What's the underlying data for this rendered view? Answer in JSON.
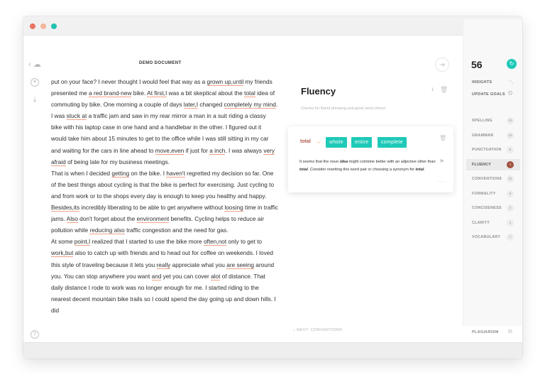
{
  "window": {
    "traffic_lights": [
      "close",
      "minimize",
      "maximize"
    ]
  },
  "document": {
    "title": "DEMO DOCUMENT",
    "paragraphs": [
      [
        {
          "t": "put on your face? I never thought I would feel that way as a "
        },
        {
          "t": "grown up,until",
          "u": true
        },
        {
          "t": " my friends presented me "
        },
        {
          "t": "a red brand-new",
          "u": true
        },
        {
          "t": " bike. "
        },
        {
          "t": "At first,I",
          "u": true
        },
        {
          "t": " was a bit skeptical about the "
        },
        {
          "t": "total",
          "u": true
        },
        {
          "t": " idea of commuting by bike. One morning a couple of days "
        },
        {
          "t": "later,I",
          "u": true
        },
        {
          "t": " changed "
        },
        {
          "t": "completely my mind",
          "u": true
        },
        {
          "t": "."
        }
      ],
      [
        {
          "t": "I was "
        },
        {
          "t": "stuck at",
          "u": true
        },
        {
          "t": " a traffic jam and saw in my rear mirror a man in a suit riding a classy bike with his laptop case in one hand and a handlebar in the other. I figured out it would take him about 15 minutes to get to the office while I was still sitting in my car and waiting for the cars in line ahead to "
        },
        {
          "t": "move,even",
          "u": true
        },
        {
          "t": " if just for "
        },
        {
          "t": "a inch",
          "u": true
        },
        {
          "t": ". I was always "
        },
        {
          "t": "very afraid",
          "u": true
        },
        {
          "t": " of being late for my business meetings."
        }
      ],
      [
        {
          "t": "That is when I decided "
        },
        {
          "t": "getting",
          "u": true
        },
        {
          "t": " on the bike. I "
        },
        {
          "t": "haven't",
          "u": true
        },
        {
          "t": " regretted my decision so far. One of the best things about cycling is that the bike is perfect for exercising. Just cycling to and from work or to the shops every day is enough to keep you healthy and happy. "
        },
        {
          "t": "Besides,its",
          "u": true
        },
        {
          "t": " incredibly liberating to be able to get anywhere without "
        },
        {
          "t": "loosing",
          "u": true
        },
        {
          "t": " time in traffic jams. "
        },
        {
          "t": "Also",
          "u": true
        },
        {
          "t": " don't forget about the "
        },
        {
          "t": "environment",
          "u": true
        },
        {
          "t": " benefits. Cycling helps to reduce air pollution while "
        },
        {
          "t": "reducing also",
          "u": true
        },
        {
          "t": " traffic congestion and the need for gas."
        }
      ],
      [
        {
          "t": "At some "
        },
        {
          "t": "point,I",
          "u": true
        },
        {
          "t": " realized that I started to use the bike more "
        },
        {
          "t": "often,not",
          "u": true
        },
        {
          "t": " only to get to "
        },
        {
          "t": "work,but",
          "u": true
        },
        {
          "t": " also to catch up with friends and to head out for coffee on weekends. I loved this style of traveling because it lets you "
        },
        {
          "t": "really",
          "u": true
        },
        {
          "t": " appreciate what you "
        },
        {
          "t": "are seeing",
          "u": true
        },
        {
          "t": " around you. You can stop anywhere you want "
        },
        {
          "t": "and",
          "u": true
        },
        {
          "t": " yet you can cover "
        },
        {
          "t": "alot",
          "u": true
        },
        {
          "t": " of distance. That daily distance I rode to work was no longer enough for me. I started riding to the nearest decent mountain bike trails so I could spend the day going up and down hills. I did"
        }
      ]
    ]
  },
  "card": {
    "title": "Fluency",
    "count": "1",
    "subtitle": "Checks for fluent phrasing and good word choice"
  },
  "suggestion": {
    "word": "total",
    "alternatives": [
      "whole",
      "entire",
      "complete"
    ],
    "explanation_parts": [
      {
        "t": "It seems that the noun "
      },
      {
        "t": "idea",
        "b": true
      },
      {
        "t": " might combine better with an adjective other than "
      },
      {
        "t": "total",
        "b": true
      },
      {
        "t": ". Consider rewriting this word pair or choosing a synonym for "
      },
      {
        "t": "total",
        "b": true
      },
      {
        "t": "."
      }
    ]
  },
  "next": {
    "label": "NEXT: CONVENTIONS"
  },
  "sidebar": {
    "score": "56",
    "insights_label": "INSIGHTS",
    "goals_label": "UPDATE GOALS",
    "categories": [
      {
        "label": "SPELLING",
        "count": "10",
        "active": false
      },
      {
        "label": "GRAMMAR",
        "count": "15",
        "active": false
      },
      {
        "label": "PUNCTUATION",
        "count": "6",
        "active": false
      },
      {
        "label": "FLUENCY",
        "count": "1",
        "active": true
      },
      {
        "label": "CONVENTIONS",
        "count": "23",
        "active": false
      },
      {
        "label": "FORMALITY",
        "count": "9",
        "active": false
      },
      {
        "label": "CONCISENESS",
        "count": "2",
        "active": false
      },
      {
        "label": "CLARITY",
        "count": "1",
        "active": false
      },
      {
        "label": "VOCABULARY",
        "count": "7",
        "active": false
      }
    ],
    "plagiarism_label": "PLAGIARISM"
  },
  "colors": {
    "accent": "#1ec9b8",
    "underline": "#f0a184",
    "issue_word": "#b05c4f"
  }
}
